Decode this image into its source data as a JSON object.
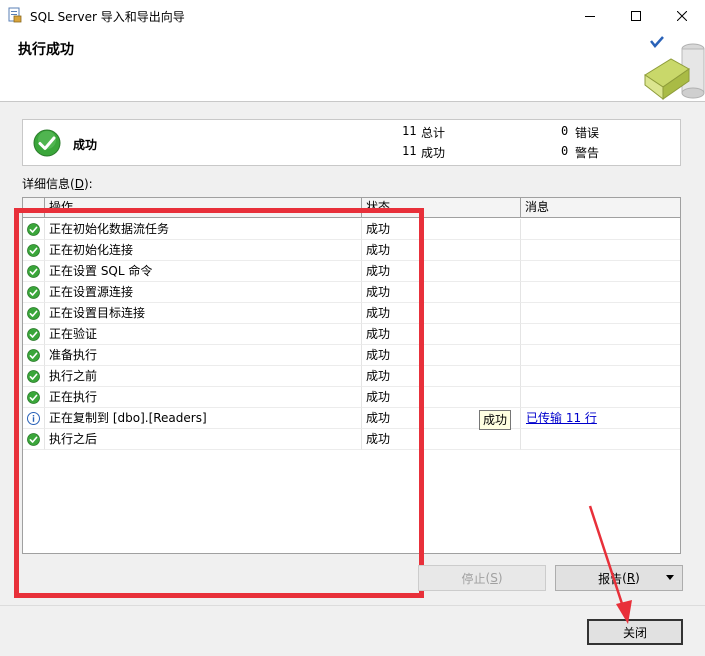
{
  "window": {
    "title": "SQL Server 导入和导出向导"
  },
  "header": {
    "title": "执行成功"
  },
  "summary": {
    "status": "成功",
    "total_count": "11",
    "total_label": "总计",
    "success_count": "11",
    "success_label": "成功",
    "error_count": "0",
    "error_label": "错误",
    "warning_count": "0",
    "warning_label": "警告"
  },
  "details": {
    "label": "详细信息",
    "mnemonic": "D",
    "columns": [
      "操作",
      "状态",
      "消息"
    ],
    "rows": [
      {
        "icon": "success-check-icon",
        "operation": "正在初始化数据流任务",
        "status": "成功",
        "message": ""
      },
      {
        "icon": "success-check-icon",
        "operation": "正在初始化连接",
        "status": "成功",
        "message": ""
      },
      {
        "icon": "success-check-icon",
        "operation": "正在设置 SQL 命令",
        "status": "成功",
        "message": ""
      },
      {
        "icon": "success-check-icon",
        "operation": "正在设置源连接",
        "status": "成功",
        "message": ""
      },
      {
        "icon": "success-check-icon",
        "operation": "正在设置目标连接",
        "status": "成功",
        "message": ""
      },
      {
        "icon": "success-check-icon",
        "operation": "正在验证",
        "status": "成功",
        "message": ""
      },
      {
        "icon": "success-check-icon",
        "operation": "准备执行",
        "status": "成功",
        "message": ""
      },
      {
        "icon": "success-check-icon",
        "operation": "执行之前",
        "status": "成功",
        "message": ""
      },
      {
        "icon": "success-check-icon",
        "operation": "正在执行",
        "status": "成功",
        "message": ""
      },
      {
        "icon": "info-icon",
        "operation": "正在复制到 [dbo].[Readers]",
        "status": "成功",
        "message": "已传输 11 行"
      },
      {
        "icon": "success-check-icon",
        "operation": "执行之后",
        "status": "成功",
        "message": ""
      }
    ],
    "tooltip": "成功"
  },
  "buttons": {
    "stop": {
      "label": "停止",
      "mnemonic": "S"
    },
    "report": {
      "label": "报告",
      "mnemonic": "R"
    },
    "close": {
      "label": "关闭"
    }
  },
  "colors": {
    "success_green": "#3aa63a",
    "info_blue": "#2a62b8",
    "annotation_red": "#e8303a",
    "link_blue": "#0000cc"
  }
}
